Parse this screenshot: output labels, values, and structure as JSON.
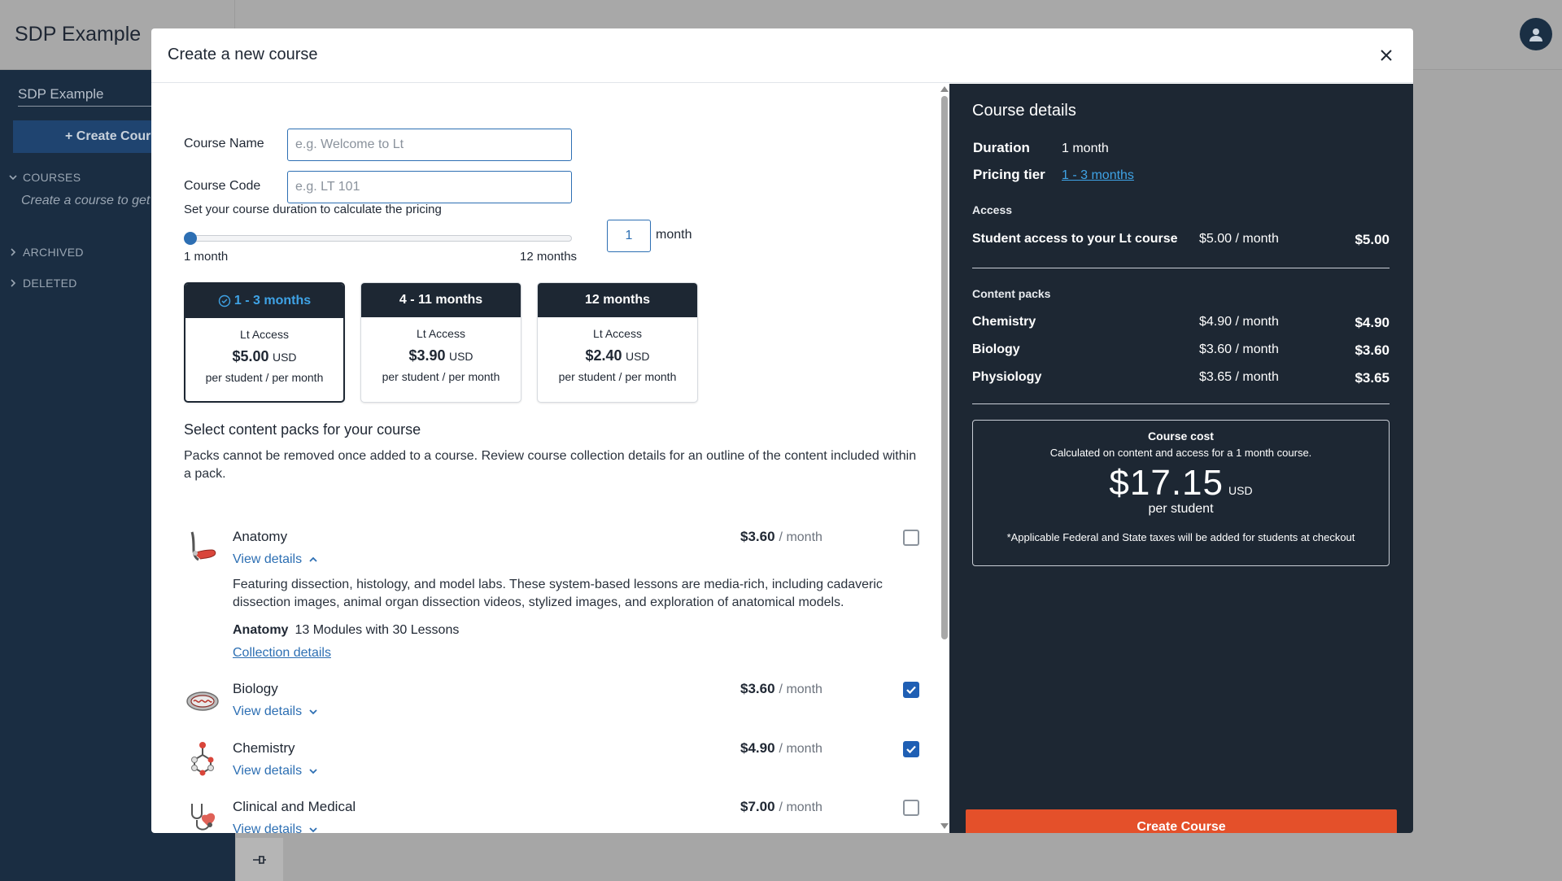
{
  "app": {
    "title": "SDP Example",
    "sidebar": {
      "heading": "SDP Example",
      "create_label": "+ Create Cour",
      "sections": {
        "courses": "COURSES",
        "archived": "ARCHIVED",
        "deleted": "DELETED"
      },
      "courses_note": "Create a course to get"
    }
  },
  "modal": {
    "title": "Create a new course",
    "form": {
      "course_name_label": "Course Name",
      "course_name_placeholder": "e.g. Welcome to Lt",
      "course_code_label": "Course Code",
      "course_code_placeholder": "e.g. LT 101"
    },
    "duration": {
      "label": "Set your course duration to calculate the pricing",
      "min_label": "1 month",
      "max_label": "12 months",
      "value": "1",
      "unit": "month",
      "slider_fraction": 0
    },
    "tiers": [
      {
        "title": "1 - 3 months",
        "access": "Lt Access",
        "price": "$5.00",
        "currency": "USD",
        "per": "per student / per month",
        "selected": true
      },
      {
        "title": "4 - 11 months",
        "access": "Lt Access",
        "price": "$3.90",
        "currency": "USD",
        "per": "per student / per month",
        "selected": false
      },
      {
        "title": "12 months",
        "access": "Lt Access",
        "price": "$2.40",
        "currency": "USD",
        "per": "per student / per month",
        "selected": false
      }
    ],
    "packs": {
      "title": "Select content packs for your course",
      "description": "Packs cannot be removed once added to a course. Review course collection details for an outline of the content included within a pack.",
      "per_month": "/ month",
      "view_details": "View details",
      "items": [
        {
          "name": "Anatomy",
          "price": "$3.60",
          "checked": false,
          "icon": "anatomy-arm-icon"
        },
        {
          "name": "Biology",
          "price": "$3.60",
          "checked": true,
          "icon": "cell-icon"
        },
        {
          "name": "Chemistry",
          "price": "$4.90",
          "checked": true,
          "icon": "molecule-icon"
        },
        {
          "name": "Clinical and Medical",
          "price": "$7.00",
          "checked": false,
          "icon": "stethoscope-icon"
        }
      ],
      "anatomy_details": {
        "description": "Featuring dissection, histology, and model labs. These system-based lessons are media-rich, including cadaveric dissection images, animal organ dissection videos, stylized images, and exploration of anatomical models.",
        "meta_name": "Anatomy",
        "meta_text": "13 Modules with 30 Lessons",
        "collection_link": "Collection details"
      }
    },
    "details": {
      "title": "Course details",
      "duration_label": "Duration",
      "duration_value": "1 month",
      "tier_label": "Pricing tier",
      "tier_value": "1 - 3 months",
      "access_heading": "Access",
      "access_row": {
        "name": "Student access to your Lt course",
        "rate": "$5.00 / month",
        "total": "$5.00"
      },
      "content_heading": "Content packs",
      "content_rows": [
        {
          "name": "Chemistry",
          "rate": "$4.90 / month",
          "total": "$4.90"
        },
        {
          "name": "Biology",
          "rate": "$3.60 / month",
          "total": "$3.60"
        },
        {
          "name": "Physiology",
          "rate": "$3.65 / month",
          "total": "$3.65"
        }
      ],
      "cost": {
        "title": "Course cost",
        "subtitle": "Calculated on content and access for a 1 month course.",
        "amount": "$17.15",
        "currency": "USD",
        "per": "per student",
        "note": "*Applicable Federal and State taxes will be added for students at checkout"
      },
      "create_button": "Create Course"
    }
  },
  "colors": {
    "accent": "#2d6fb3",
    "dark": "#1d2733",
    "cta": "#e4502a",
    "link_light": "#3fa3e6"
  }
}
